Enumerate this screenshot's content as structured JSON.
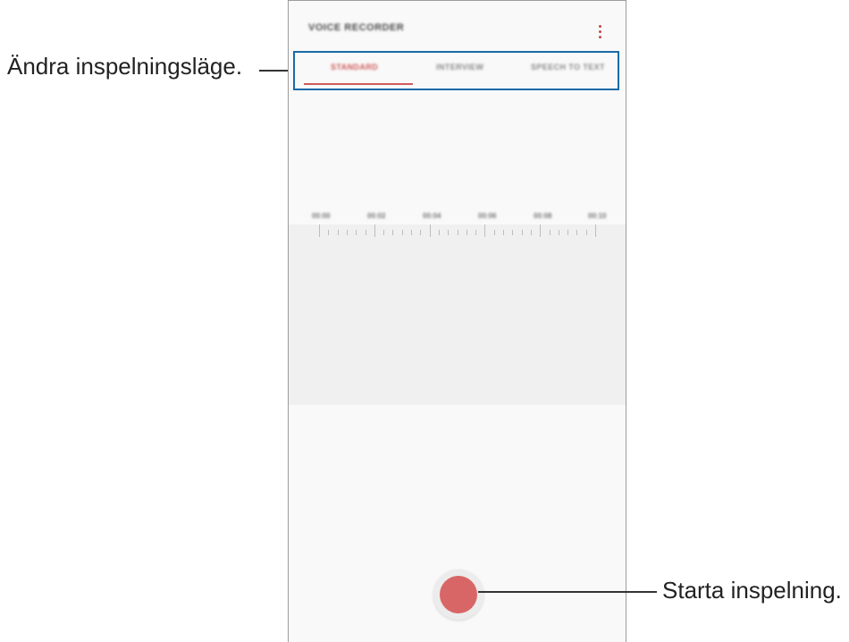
{
  "app": {
    "title": "VOICE RECORDER"
  },
  "tabs": [
    {
      "label": "STANDARD",
      "active": true
    },
    {
      "label": "INTERVIEW",
      "active": false
    },
    {
      "label": "SPEECH TO TEXT",
      "active": false
    }
  ],
  "timeline": {
    "labels": [
      "00:00",
      "00:02",
      "00:04",
      "00:06",
      "00:08",
      "00:10"
    ]
  },
  "callouts": {
    "mode": "Ändra inspelningsläge.",
    "record": "Starta inspelning."
  },
  "colors": {
    "accent": "#d96666",
    "highlight_box": "#1b6aa6"
  },
  "icons": {
    "more": "more-vertical-icon",
    "record": "record-icon"
  }
}
